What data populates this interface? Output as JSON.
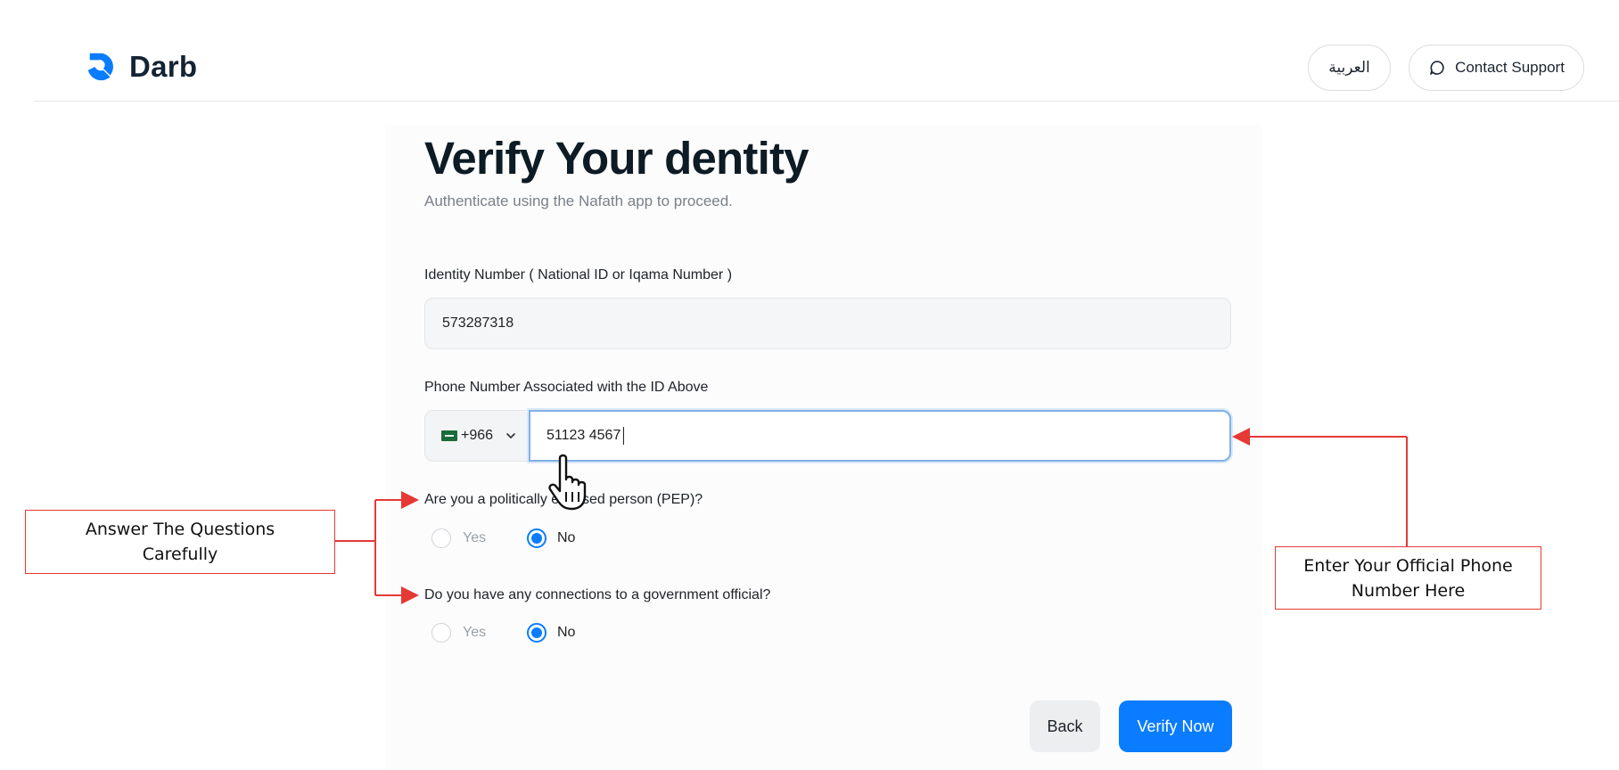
{
  "header": {
    "logo_text": "Darb",
    "lang_label": "العربية",
    "support_label": "Contact Support"
  },
  "form": {
    "title": "Verify Your dentity",
    "subtitle": "Authenticate using the Nafath app to proceed.",
    "id_label": "Identity Number ( National ID or Iqama Number )",
    "id_value": "573287318",
    "phone_label": "Phone Number Associated with the ID Above",
    "country_code": "+966",
    "phone_value": "51123 4567",
    "q1": "Are you a politically exposed person (PEP)?",
    "q2": "Do you have any connections to a government official?",
    "yes_label": "Yes",
    "no_label": "No",
    "q1_selected": "No",
    "q2_selected": "No",
    "back_label": "Back",
    "verify_label": "Verify Now"
  },
  "annotations": {
    "left_line1": "Answer The Questions",
    "left_line2": "Carefully",
    "right_line1": "Enter Your Official Phone",
    "right_line2": "Number Here"
  },
  "colors": {
    "primary": "#0a7cff",
    "annotation": "#e53935",
    "logo": "#0a7cff"
  },
  "icons": [
    "darb-logo-icon",
    "chat-bubble-icon",
    "saudi-flag-icon",
    "chevron-down-icon",
    "hand-pointer-icon"
  ]
}
